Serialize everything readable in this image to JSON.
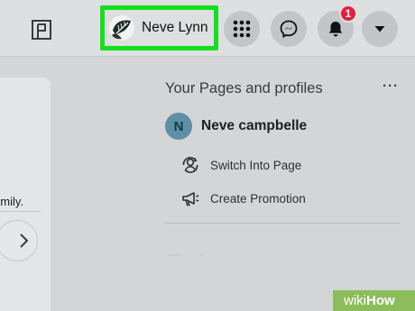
{
  "topbar": {
    "profile": {
      "name": "Neve Lynn",
      "avatar_icon": "monstera-leaf-avatar"
    },
    "icons": {
      "pages": "pages-flag-icon",
      "menu": "grid-menu-icon",
      "messenger": "messenger-icon",
      "notifications": "bell-icon",
      "account": "caret-down-icon"
    },
    "notification_count": "1",
    "highlight_color": "#14e01e",
    "badge_color": "#e41e3f"
  },
  "left_card": {
    "text_fragment": "mily.",
    "next_icon": "chevron-right-icon"
  },
  "pages_panel": {
    "title": "Your Pages and profiles",
    "more_label": "···",
    "page": {
      "avatar_letter": "N",
      "name": "Neve campbelle",
      "avatar_color": "#5d8fa6"
    },
    "actions": [
      {
        "label": "Switch Into Page",
        "icon": "switch-profile-icon"
      },
      {
        "label": "Create Promotion",
        "icon": "megaphone-icon"
      }
    ]
  },
  "watermark": {
    "part1": "wiki",
    "part2": "How",
    "color": "#8cbd5a"
  }
}
